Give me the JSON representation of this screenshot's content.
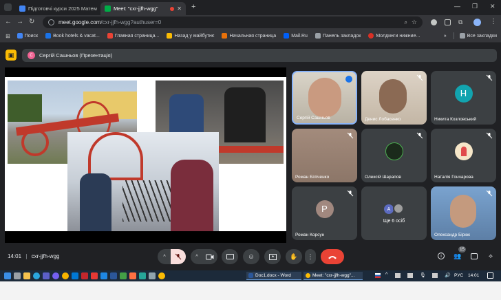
{
  "browser": {
    "tabs": [
      {
        "label": "Підготовчі курси 2025 Матем",
        "active": false,
        "favicon_color": "#4285f4"
      },
      {
        "label": "Meet: \"cxr-jjfh-wgg\"",
        "active": true,
        "favicon_color": "#00ac47"
      }
    ],
    "new_tab": "+",
    "window_controls": [
      "—",
      "❐",
      "✕"
    ],
    "url_host": "meet.google.com",
    "url_path": "/cxr-jjfh-wgg?authuser=0",
    "bookmarks": [
      {
        "label": "Поиск",
        "color": "#4285f4"
      },
      {
        "label": "Book hotels & vacat...",
        "color": "#1a73e8"
      },
      {
        "label": "Главная страница...",
        "color": "#ea4335"
      },
      {
        "label": "Назад у майбутнє",
        "color": "#fbbc04"
      },
      {
        "label": "Начальная страница",
        "color": "#e8710a"
      },
      {
        "label": "Mail.Ru",
        "color": "#005ff9"
      },
      {
        "label": "Панель закладок",
        "color": "#9aa0a6"
      },
      {
        "label": "Молдинги нижние...",
        "color": "#d93025"
      }
    ],
    "bookmarks_more": "»",
    "all_bookmarks": "Все закладки"
  },
  "meet": {
    "presenter_initial": "С",
    "presenter_label": "Сергій Сашньов (Презентація)",
    "meeting_time": "14:01",
    "meeting_code": "cxr-jjfh-wgg",
    "participants_count": "15",
    "tiles": [
      {
        "name": "Сергій Сашньов",
        "kind": "video",
        "speaking": true
      },
      {
        "name": "Денис Лобасенко",
        "kind": "video",
        "muted": true
      },
      {
        "name": "Никита Козловський",
        "kind": "initial",
        "initial": "Н",
        "color": "#12a4af",
        "muted": true
      },
      {
        "name": "Роман Біліченко",
        "kind": "video",
        "muted": true
      },
      {
        "name": "Олексій Шарапов",
        "kind": "avatar",
        "muted": true
      },
      {
        "name": "Наталія Гончарова",
        "kind": "avatar",
        "muted": true
      },
      {
        "name": "Роман Корсун",
        "kind": "initial",
        "initial": "P",
        "color": "#a1887f",
        "muted": true
      },
      {
        "name": "Ще 6 осіб",
        "kind": "more",
        "initial": "А"
      },
      {
        "name": "Олександр Бірюк",
        "kind": "video",
        "muted": true
      }
    ]
  },
  "taskbar": {
    "apps": [
      "Doc1.docx - Word",
      "Meet: \"cxr-jjfh-wgg\"..."
    ],
    "language": "РУС",
    "clock": "14:01"
  },
  "colors": {
    "end_call": "#ea4335",
    "mic_off": "#f9dedc",
    "slide_stripe": "#e57c3b",
    "machine_red": "#c0392b"
  }
}
